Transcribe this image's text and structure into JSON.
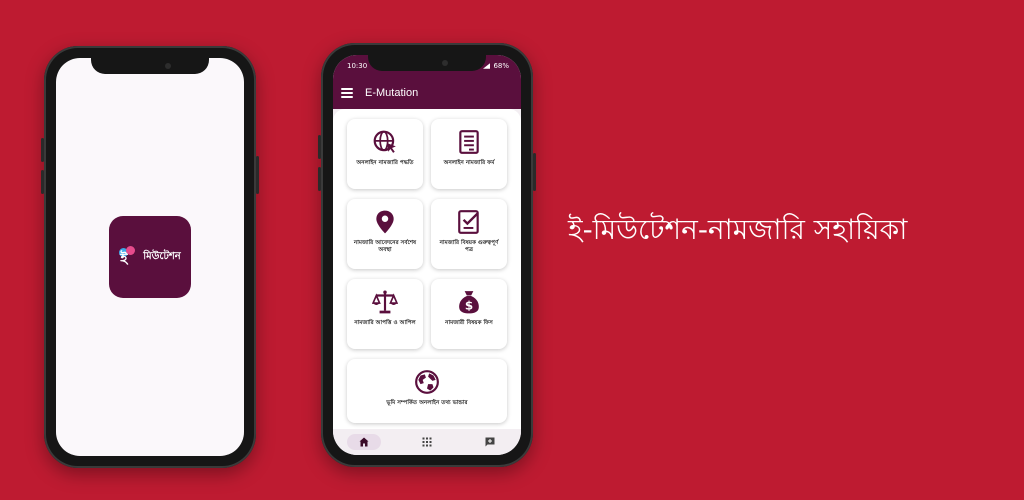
{
  "colors": {
    "background": "#be1b31",
    "primary": "#5a0f3d",
    "logo_blue": "#3da7e6",
    "logo_pink": "#e64b8c"
  },
  "splash": {
    "logo_glyph": "ই",
    "logo_text": "মিউটেশন"
  },
  "status_bar": {
    "time": "10:30",
    "battery": "68%"
  },
  "app_bar": {
    "title": "E-Mutation",
    "menu_icon": "hamburger-menu-icon"
  },
  "menu_items": [
    {
      "label": "অনলাইন নামজারি পদ্ধতি",
      "icon": "globe-cursor-icon"
    },
    {
      "label": "অনলাইন নামজারি ফর্ম",
      "icon": "form-document-icon"
    },
    {
      "label": "নামজারি আবেদনের সর্বশেষ অবস্থা",
      "icon": "location-pin-icon"
    },
    {
      "label": "নামজারি বিষয়ক গুরুত্বপূর্ণ পত্র",
      "icon": "checked-document-icon"
    },
    {
      "label": "নামজারি আপত্তি ও আপিল",
      "icon": "justice-scale-icon"
    },
    {
      "label": "নামজারী বিষয়ক ফিস",
      "icon": "money-bag-icon"
    },
    {
      "label": "ভূমি সম্পর্কিত অনলাইন তথ্য ভান্ডার",
      "icon": "earth-globe-icon"
    }
  ],
  "bottom_nav": [
    {
      "icon": "home-icon",
      "active": true
    },
    {
      "icon": "apps-grid-icon",
      "active": false
    },
    {
      "icon": "add-feedback-icon",
      "active": false
    }
  ],
  "tagline": "ই-মিউটেশন-নামজারি সহায়িকা"
}
